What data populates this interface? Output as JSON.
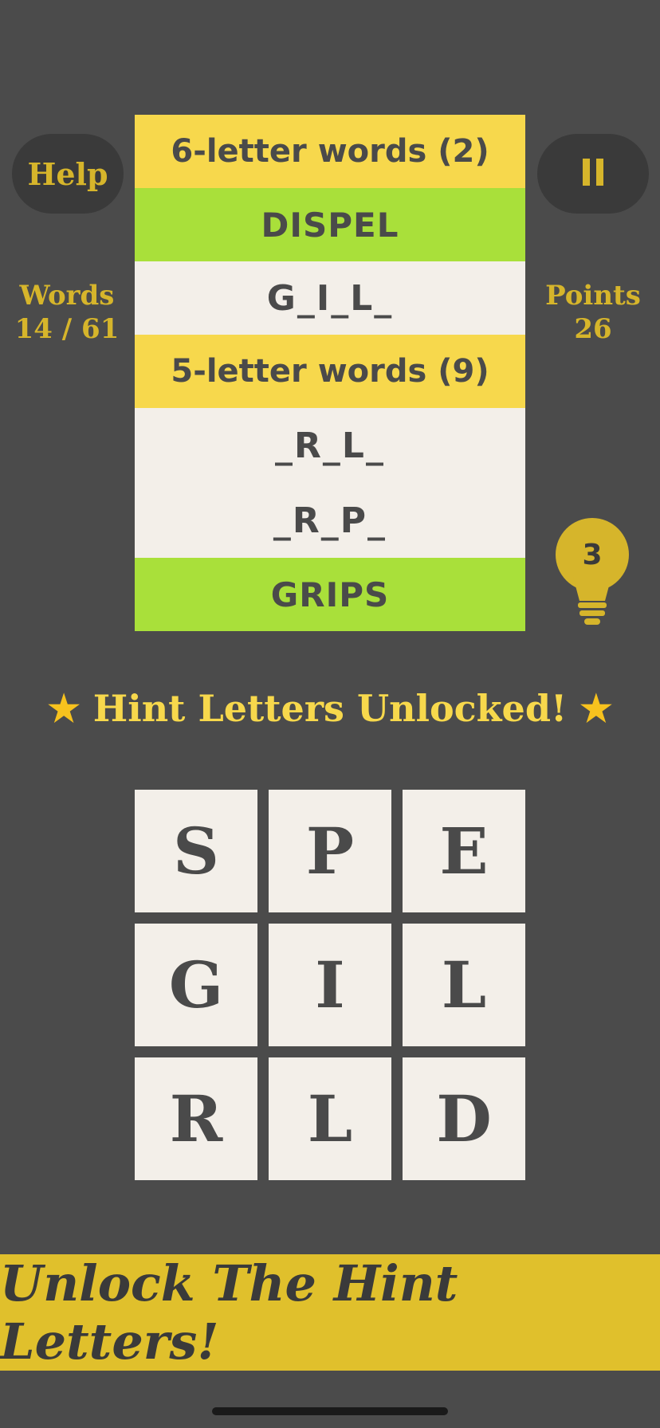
{
  "header": {
    "help_label": "Help",
    "pause_icon": "pause-icon"
  },
  "stats": {
    "words_label": "Words",
    "words_value": "14 / 61",
    "points_label": "Points",
    "points_value": "26"
  },
  "word_list": {
    "groups": [
      {
        "header": "6-letter words (2)",
        "rows": [
          {
            "text": "DISPEL",
            "state": "found"
          },
          {
            "text": "G_I_L_",
            "state": "masked"
          }
        ]
      },
      {
        "header": "5-letter words (9)",
        "rows": [
          {
            "text": "_R_L_",
            "state": "masked"
          },
          {
            "text": "_R_P_",
            "state": "masked"
          },
          {
            "text": "GRIPS",
            "state": "found"
          }
        ]
      }
    ]
  },
  "hint": {
    "count": "3",
    "icon": "lightbulb-icon"
  },
  "banner": {
    "text": "Hint Letters Unlocked!",
    "star_icon": "star-icon"
  },
  "letter_grid": {
    "tiles": [
      "S",
      "P",
      "E",
      "G",
      "I",
      "L",
      "R",
      "L",
      "D"
    ]
  },
  "unlock_bar": {
    "label": "Unlock The Hint Letters!"
  },
  "colors": {
    "background": "#4b4b4b",
    "accent_gold": "#d6b52b",
    "header_yellow": "#f7d84c",
    "found_green": "#a9e03a",
    "tile_cream": "#f3efe9",
    "unlock_bar": "#e0c02c"
  }
}
